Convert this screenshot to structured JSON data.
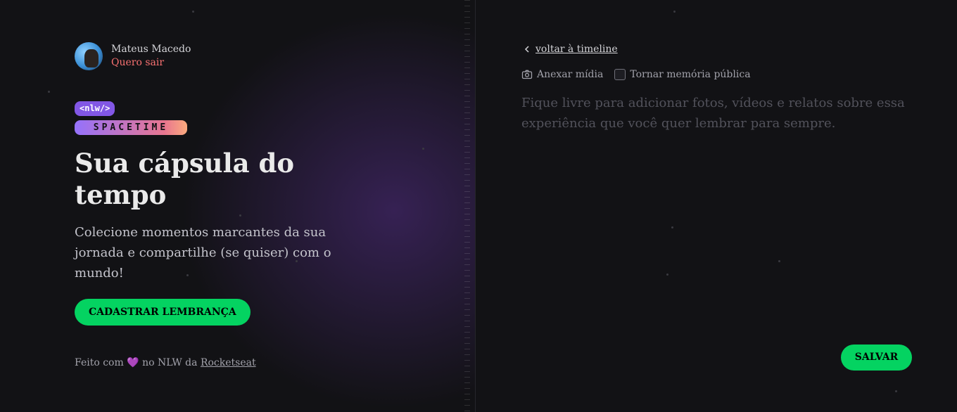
{
  "profile": {
    "name": "Mateus Macedo",
    "logout": "Quero sair"
  },
  "logo": {
    "tag": "<nlw/>",
    "word": "SPACETIME"
  },
  "hero": {
    "title": "Sua cápsula do tempo",
    "subtitle": "Colecione momentos marcantes da sua jornada e compartilhe (se quiser) com o mundo!",
    "cta": "CADASTRAR LEMBRANÇA"
  },
  "footer": {
    "prefix": "Feito com",
    "heart": "💜",
    "middle": "no NLW da",
    "link": "Rocketseat"
  },
  "form": {
    "back": "voltar à timeline",
    "attach": "Anexar mídia",
    "public": "Tornar memória pública",
    "placeholder": "Fique livre para adicionar fotos, vídeos e relatos sobre essa experiência que você quer lembrar para sempre.",
    "save": "SALVAR"
  },
  "colors": {
    "accent_green": "#04d361",
    "purple": "#8257e5",
    "logout_red": "#f87171",
    "background": "#121215"
  },
  "icons": {
    "back": "chevron-left-icon",
    "attach": "camera-icon"
  }
}
